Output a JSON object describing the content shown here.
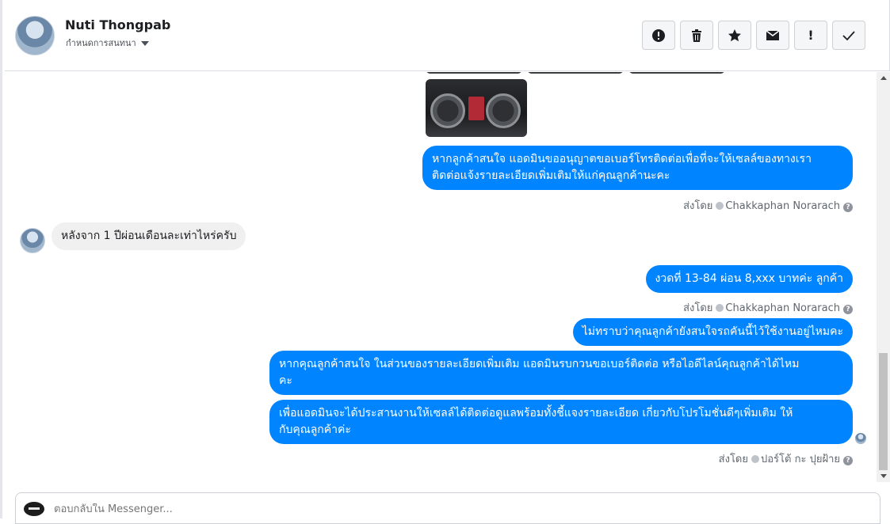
{
  "header": {
    "contact_name": "Nuti Thongpab",
    "assign_label": "กำหนดการสนทนา",
    "actions": [
      {
        "icon": "alert-circle-icon",
        "glyph": ""
      },
      {
        "icon": "trash-icon",
        "glyph": ""
      },
      {
        "icon": "star-icon",
        "glyph": ""
      },
      {
        "icon": "envelope-icon",
        "glyph": ""
      },
      {
        "icon": "exclamation-icon",
        "glyph": "!"
      },
      {
        "icon": "checkmark-icon",
        "glyph": ""
      }
    ]
  },
  "messages": {
    "m1": "หากลูกค้าสนใจ แอดมินขออนุญาตขอเบอร์โทรติดต่อเพื่อที่จะให้เซลล์ของทางเรา",
    "m1b": "ติดต่อแจ้งรายละเอียดเพิ่มเติมให้แก่คุณลูกค้านะคะ",
    "m2": "หลังจาก 1 ปีผ่อนเดือนละเท่าไหร่ครับ",
    "m3": "งวดที่ 13-84 ผ่อน 8,xxx บาทค่ะ ลูกค้า",
    "m4": "ไม่ทราบว่าคุณลูกค้ายังสนใจรถคันนี้ไว้ใช้งานอยู่ไหมคะ",
    "m5": "หากคุณลูกค้าสนใจ ในส่วนของรายละเอียดเพิ่มเติม แอดมินรบกวนขอเบอร์ติดต่อ หรือไอดีไลน์คุณลูกค้าได้ไหม",
    "m5b": "คะ",
    "m6": "เพื่อแอดมินจะได้ประสานงานให้เซลล์ได้ติดต่อดูแลพร้อมทั้งชี้แจงรายละเอียด เกี่ยวกับโปรโมชั่นดีๆเพิ่มเติม ให้",
    "m6b": "กับคุณลูกค้าค่ะ"
  },
  "sent_by": {
    "label": "ส่งโดย",
    "agent1": "Chakkaphan Norarach",
    "agent2": "Chakkaphan Norarach",
    "agent3": "ปอร์โต้ กะ ปุยฝ้าย"
  },
  "composer": {
    "placeholder": "ตอบกลับใน Messenger..."
  },
  "colors": {
    "outgoing": "#0084ff",
    "incoming": "#f1f0f0"
  }
}
